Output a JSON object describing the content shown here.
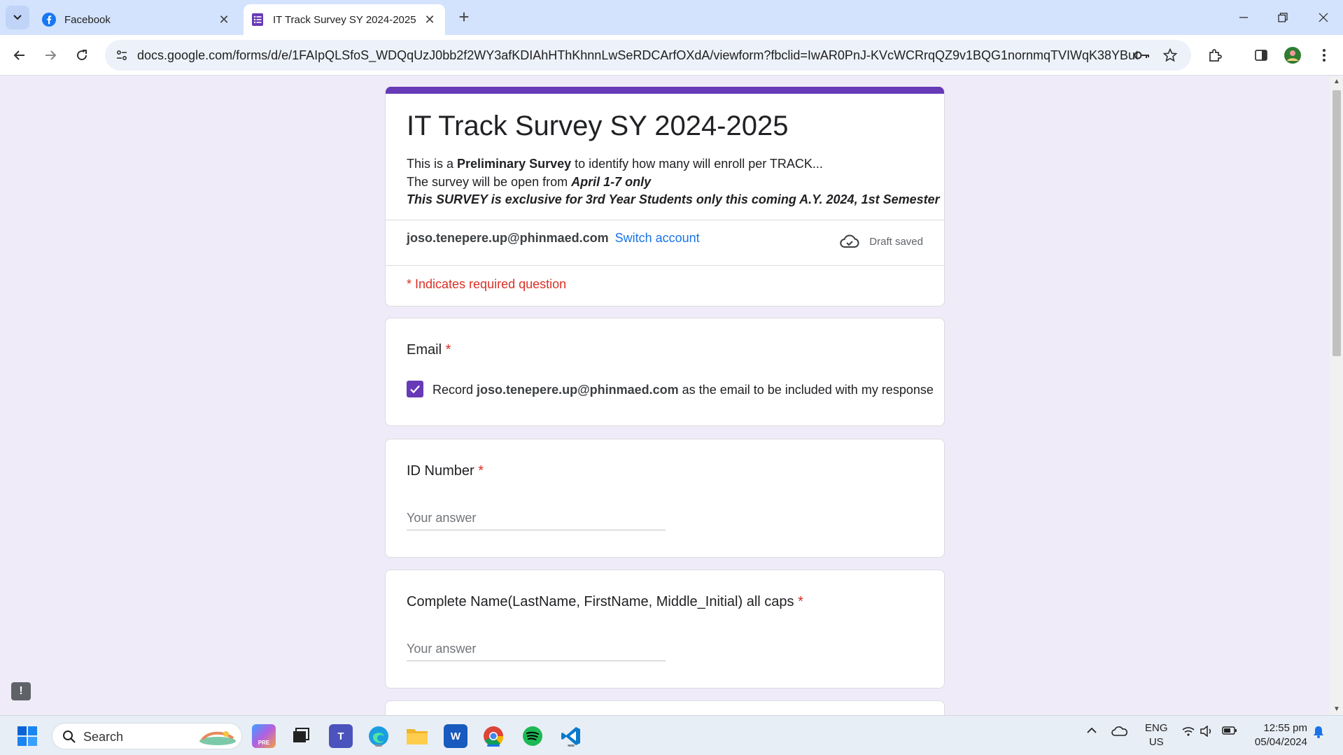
{
  "browser": {
    "tabs": [
      {
        "title": "Facebook",
        "icon": "facebook-icon",
        "active": false
      },
      {
        "title": "IT Track Survey SY 2024-2025",
        "icon": "google-forms-icon",
        "active": true
      }
    ],
    "url": "docs.google.com/forms/d/e/1FAIpQLSfoS_WDQqUzJ0bb2f2WY3afKDIAhHThKhnnLwSeRDCArfOXdA/viewform?fbclid=IwAR0PnJ-KVcWCRrqQZ9v1BQG1nornmqTVIWqK38YButMhqaX..."
  },
  "form": {
    "title": "IT Track Survey SY 2024-2025",
    "description": {
      "line1_pre": "This is a ",
      "line1_bold": "Preliminary Survey",
      "line1_post": " to identify how many will enroll per TRACK...",
      "line2_pre": "The survey will be open from ",
      "line2_bold": "April 1-7 only",
      "line3": "This SURVEY is exclusive for 3rd Year Students only this coming A.Y. 2024, 1st Semester"
    },
    "account_email": "joso.tenepere.up@phinmaed.com",
    "switch_account": "Switch account",
    "draft_status": "Draft saved",
    "required_note": "* Indicates required question",
    "required_marker": "*"
  },
  "questions": {
    "email": {
      "title": "Email",
      "record_pre": "Record",
      "record_email": "joso.tenepere.up@phinmaed.com",
      "record_post": "as the email to be included with my response",
      "checked": true
    },
    "id_number": {
      "title": "ID Number",
      "placeholder": "Your answer"
    },
    "complete_name": {
      "title": "Complete Name(LastName, FirstName, Middle_Initial) all caps",
      "placeholder": "Your answer"
    }
  },
  "taskbar": {
    "search_label": "Search",
    "lang_line1": "ENG",
    "lang_line2": "US",
    "time": "12:55 pm",
    "date": "05/04/2024"
  },
  "colors": {
    "form_accent": "#673ab7",
    "page_bg": "#f0ebf8",
    "required": "#d93025",
    "link": "#1a73e8"
  }
}
